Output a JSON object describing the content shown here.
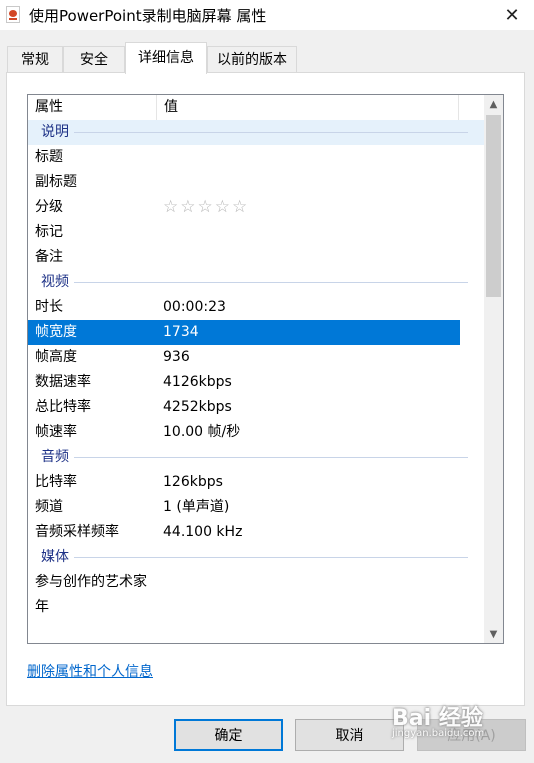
{
  "window": {
    "title": "使用PowerPoint录制电脑屏幕 属性",
    "close_glyph": "✕"
  },
  "tabs": [
    {
      "label": "常规"
    },
    {
      "label": "安全"
    },
    {
      "label": "详细信息"
    },
    {
      "label": "以前的版本"
    }
  ],
  "list": {
    "columns": {
      "property": "属性",
      "value": "值"
    },
    "groups": {
      "description": "说明",
      "video": "视频",
      "audio": "音频",
      "media": "媒体"
    },
    "description_rows": [
      {
        "key": "标题",
        "value": ""
      },
      {
        "key": "副标题",
        "value": ""
      },
      {
        "key": "分级",
        "value": "☆☆☆☆☆"
      },
      {
        "key": "标记",
        "value": ""
      },
      {
        "key": "备注",
        "value": ""
      }
    ],
    "video_rows": [
      {
        "key": "时长",
        "value": "00:00:23"
      },
      {
        "key": "帧宽度",
        "value": "1734"
      },
      {
        "key": "帧高度",
        "value": "936"
      },
      {
        "key": "数据速率",
        "value": "4126kbps"
      },
      {
        "key": "总比特率",
        "value": "4252kbps"
      },
      {
        "key": "帧速率",
        "value": "10.00 帧/秒"
      }
    ],
    "audio_rows": [
      {
        "key": "比特率",
        "value": "126kbps"
      },
      {
        "key": "频道",
        "value": "1 (单声道)"
      },
      {
        "key": "音频采样频率",
        "value": "44.100 kHz"
      }
    ],
    "media_rows": [
      {
        "key": "参与创作的艺术家",
        "value": ""
      },
      {
        "key": "年",
        "value": ""
      }
    ],
    "selected_row": "帧宽度"
  },
  "remove_link": "删除属性和个人信息",
  "buttons": {
    "ok": "确定",
    "cancel": "取消",
    "apply": "应用(A)"
  },
  "watermark": {
    "text": "Bai 经验",
    "sub": "jingyan.baidu.com"
  },
  "colors": {
    "selection": "#0078d7",
    "link": "#0066cc",
    "group_text": "#1e3287"
  }
}
